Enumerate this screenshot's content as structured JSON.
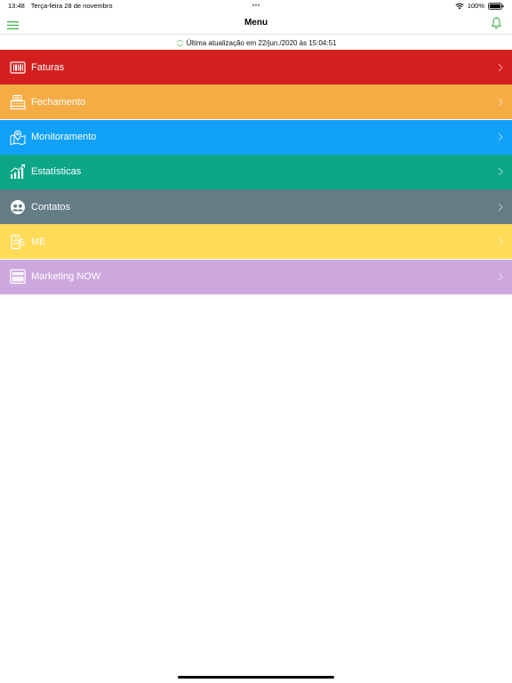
{
  "status_bar": {
    "time": "13:48",
    "date": "Terça-feira 28 de novembro",
    "dots": "•••",
    "battery": "100%"
  },
  "nav": {
    "title": "Menu"
  },
  "update": {
    "text": "Última atualização em 22/jun./2020 às 15:04:51"
  },
  "colors": {
    "accent": "#3cb04a",
    "faturas": "#d51f1f",
    "fechamento": "#f5ac45",
    "monitoramento": "#11a1f7",
    "estatisticas": "#0ca687",
    "contatos": "#647c83",
    "me": "#ffdb58",
    "marketing_now": "#cda8de"
  },
  "menu": {
    "items": [
      {
        "label": "Faturas",
        "icon": "barcode-icon"
      },
      {
        "label": "Fechamento",
        "icon": "cash-register-icon"
      },
      {
        "label": "Monitoramento",
        "icon": "map-pin-icon"
      },
      {
        "label": "Estatísticas",
        "icon": "chart-icon"
      },
      {
        "label": "Contatos",
        "icon": "contacts-icon"
      },
      {
        "label": "ME",
        "icon": "payment-icon"
      },
      {
        "label": "Marketing NOW",
        "icon": "marketing-icon"
      }
    ]
  }
}
